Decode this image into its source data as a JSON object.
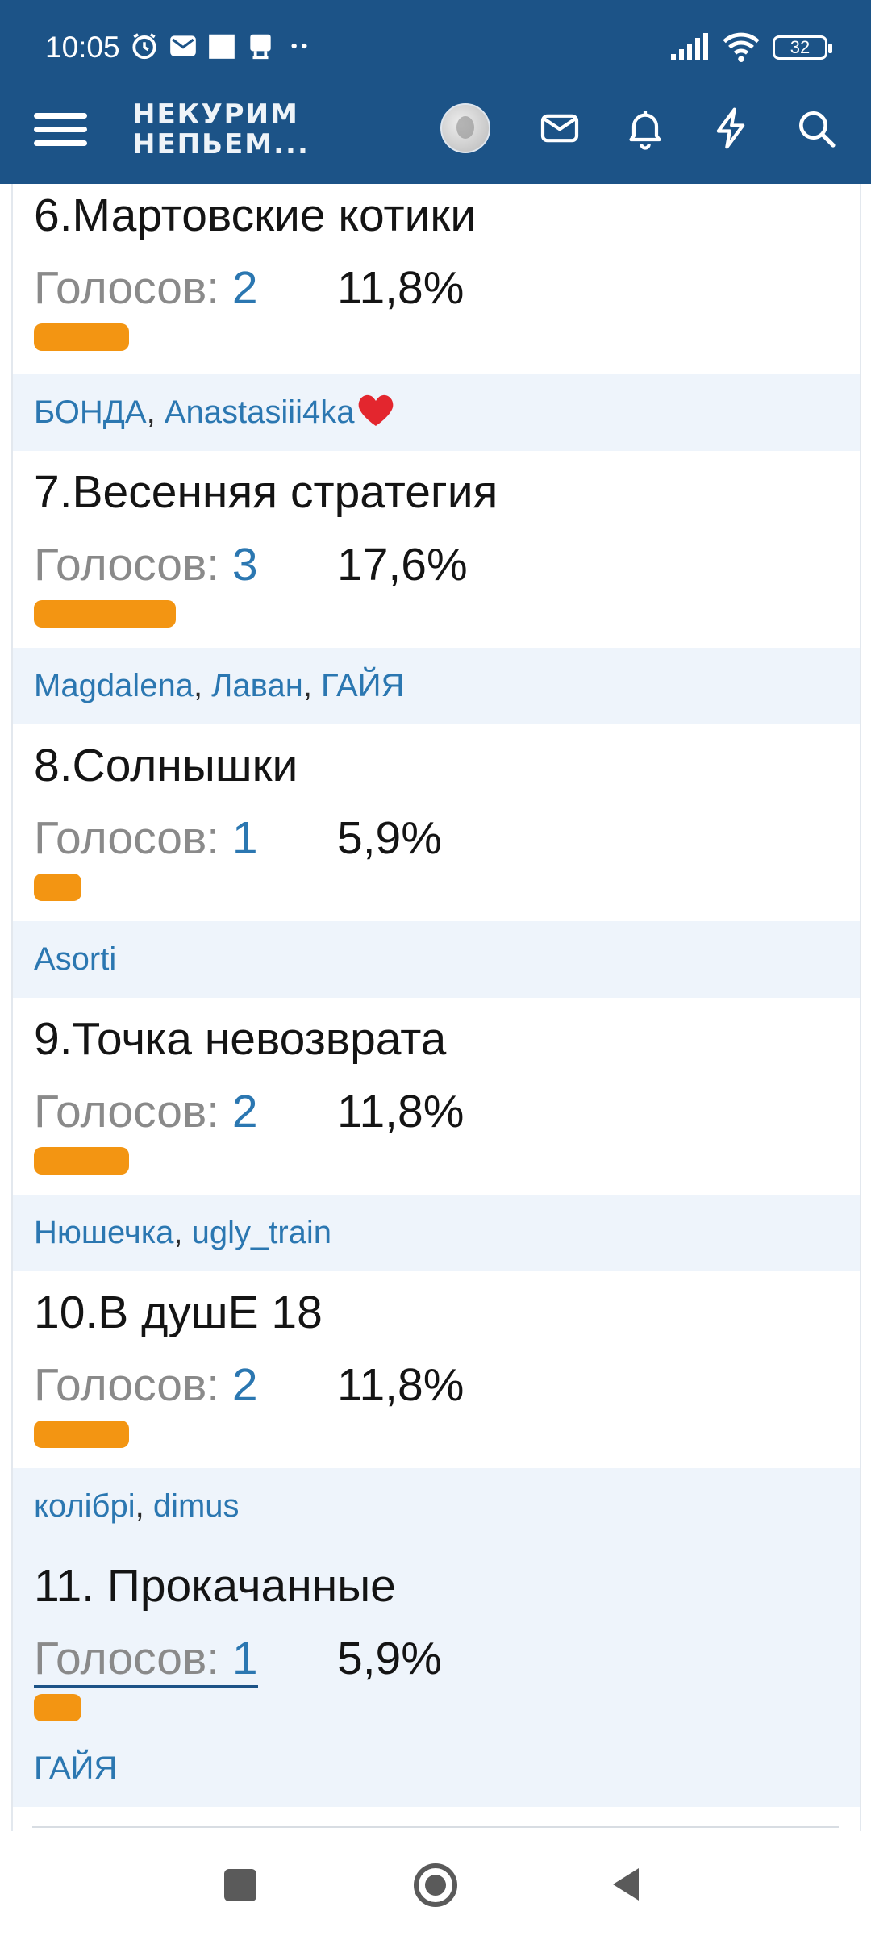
{
  "status_bar": {
    "time": "10:05",
    "battery": "32",
    "icons": [
      "alarm-icon",
      "mail-icon",
      "square-icon",
      "sim-icon",
      "more-dots-icon",
      "signal-icon",
      "wifi-icon",
      "battery-icon"
    ]
  },
  "header": {
    "logo_line1": "НЕКУРИМ",
    "logo_line2": "НЕПЬЕМ...",
    "icons": [
      "menu-icon",
      "avatar",
      "mail-icon",
      "bell-icon",
      "lightning-icon",
      "search-icon"
    ],
    "background": "#1c5387"
  },
  "poll": {
    "votes_label": "Голосов: ",
    "accent_bar_color": "#f39512",
    "link_color": "#2b77b1",
    "options": [
      {
        "title": "6.Мартовские котики",
        "votes": "2",
        "percent": "11,8%",
        "share": 0.118,
        "voters": [
          "БОНДА",
          "Anastasiii4ka"
        ]
      },
      {
        "title": "7.Весенняя стратегия",
        "votes": "3",
        "percent": "17,6%",
        "share": 0.176,
        "voters": [
          "Magdalena",
          "Лаван",
          "ГАЙЯ"
        ]
      },
      {
        "title": "8.Солнышки",
        "votes": "1",
        "percent": "5,9%",
        "share": 0.059,
        "voters": [
          "Asorti"
        ]
      },
      {
        "title": "9.Точка невозврата",
        "votes": "2",
        "percent": "11,8%",
        "share": 0.118,
        "voters": [
          "Нюшечка",
          "ugly_train"
        ]
      },
      {
        "title": "10.В душЕ 18",
        "votes": "2",
        "percent": "11,8%",
        "share": 0.118,
        "voters": [
          "колібрі",
          "dimus"
        ]
      },
      {
        "title": "11. Прокачанные",
        "votes": "1",
        "percent": "5,9%",
        "share": 0.059,
        "voters": [
          "ГАЙЯ"
        ]
      }
    ]
  },
  "system_nav": {
    "icons": [
      "recents-square-icon",
      "home-circle-icon",
      "back-triangle-icon"
    ]
  }
}
